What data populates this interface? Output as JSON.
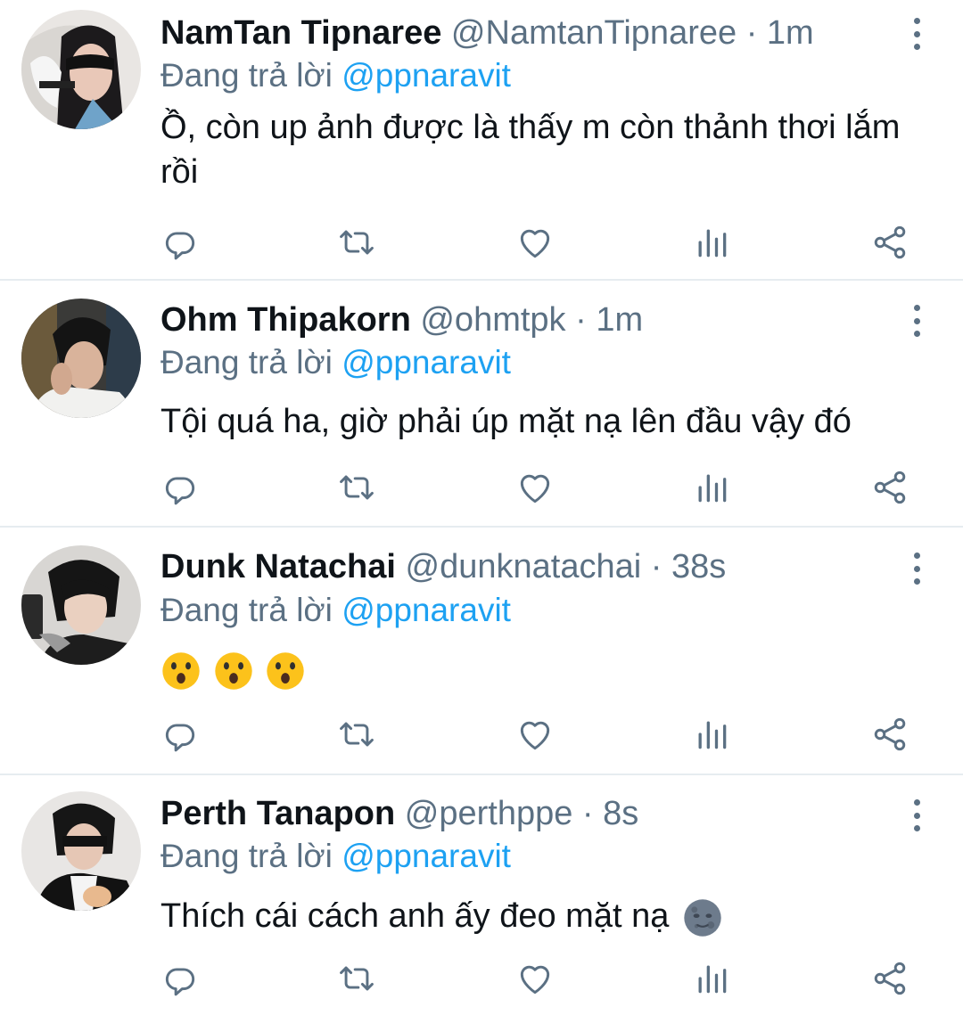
{
  "tweets": [
    {
      "name": "NamTan Tipnaree",
      "handle": "@NamtanTipnaree",
      "time": "· 1m",
      "reply_prefix": "Đang trả lời",
      "reply_to": "@ppnaravit",
      "text": "Ồ, còn up ảnh được là thấy m còn thảnh thơi lắm rồi",
      "avatar_icon": "avatar-photo"
    },
    {
      "name": "Ohm Thipakorn",
      "handle": "@ohmtpk",
      "time": "· 1m",
      "reply_prefix": "Đang trả lời",
      "reply_to": "@ppnaravit",
      "text": "Tội quá ha, giờ phải úp mặt nạ lên đầu vậy đó",
      "avatar_icon": "avatar-photo"
    },
    {
      "name": "Dunk Natachai",
      "handle": "@dunknatachai",
      "time": "· 38s",
      "reply_prefix": "Đang trả lời",
      "reply_to": "@ppnaravit",
      "text": "",
      "emoji": [
        "astonished-face-emoji",
        "astonished-face-emoji",
        "astonished-face-emoji"
      ],
      "avatar_icon": "avatar-photo"
    },
    {
      "name": "Perth Tanapon",
      "handle": "@perthppe",
      "time": "· 8s",
      "reply_prefix": "Đang trả lời",
      "reply_to": "@ppnaravit",
      "text": "Thích cái cách anh ấy đeo mặt nạ",
      "emoji_trailing": "new-moon-face-emoji",
      "avatar_icon": "avatar-photo"
    }
  ],
  "icons": {
    "reply": "reply-icon",
    "retweet": "retweet-icon",
    "like": "heart-icon",
    "analytics": "analytics-icon",
    "share": "share-icon",
    "more": "more-vertical-icon"
  },
  "colors": {
    "name": "#0f1419",
    "meta": "#5b7083",
    "link": "#1da1f2",
    "divider": "#e6ecf0",
    "icon": "#5b7083"
  }
}
